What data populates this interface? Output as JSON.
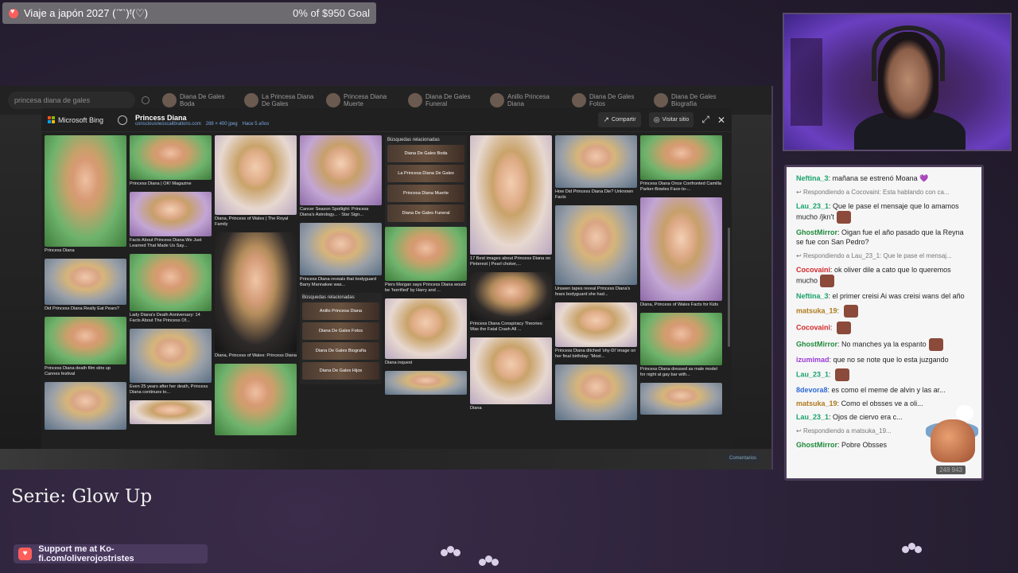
{
  "goal": {
    "title": "Viaje a japón 2027 (ˊ˘ˋ)ᶠ(♡)",
    "amount": "0% of $950 Goal"
  },
  "browser": {
    "search_query": "princesa diana de gales",
    "top_related": [
      "Diana De Gales Boda",
      "La Princesa Diana De Gales",
      "Princesa Diana Muerte",
      "Diana De Gales Funeral",
      "Anillo Princesa Diana",
      "Diana De Gales Fotos",
      "Diana De Gales Biografía"
    ],
    "modal": {
      "brand": "Microsoft Bing",
      "title": "Princess Diana",
      "source": "consciousnesscalibrations.com",
      "dims": "288 × 400 jpeg",
      "age": "Hace 5 años",
      "share_label": "Compartir",
      "visit_label": "Visitar sitio"
    },
    "columns": [
      [
        {
          "h": 140,
          "cap": "Princess Diana",
          "v": "v4"
        },
        {
          "h": 58,
          "cap": "Did Princess Diana Really Eat Pears?",
          "v": "v2"
        },
        {
          "h": 60,
          "cap": "Princess Diana death film stirs up Cannes festival",
          "v": "v4"
        },
        {
          "h": 60,
          "cap": "",
          "v": "v2"
        }
      ],
      [
        {
          "h": 56,
          "cap": "Princess Diana | OK! Magazine",
          "v": "v4"
        },
        {
          "h": 56,
          "cap": "Facts About Princess Diana We Just Learned That Made Us Say...",
          "v": "v5"
        },
        {
          "h": 72,
          "cap": "Lady Diana's Death Anniversary: 14 Facts About The Princess Of...",
          "v": "v4"
        },
        {
          "h": 68,
          "cap": "Even 25 years after her death, Princess Diana continues to...",
          "v": "v2"
        },
        {
          "h": 30,
          "cap": "",
          "v": "v3"
        }
      ],
      [
        {
          "h": 100,
          "cap": "Diana, Princess of Wales | The Royal Family",
          "v": "v3"
        },
        {
          "h": 150,
          "cap": "Diana, Princess of Wales: Princess Diana",
          "v": "v6"
        },
        {
          "h": 90,
          "cap": "",
          "v": "v4"
        }
      ],
      [
        {
          "h": 88,
          "cap": "Cancer Season Spotlight: Princess Diana's Astrology... - Star Sign...",
          "v": "v5"
        },
        {
          "h": 66,
          "cap": "Princess Diana reveals that bodyguard Barry Mannakee was...",
          "v": "v2"
        }
      ],
      [
        {
          "h": 68,
          "cap": "Piers Morgan says Princess Diana would be 'horrified' by Harry and ...",
          "v": "v4"
        },
        {
          "h": 76,
          "cap": "Diana inquest",
          "v": "v3"
        },
        {
          "h": 30,
          "cap": "",
          "v": "v2"
        }
      ],
      [
        {
          "h": 150,
          "cap": "17 Best images about Princess Diana on Pinterest | Pearl choker,...",
          "v": "v3"
        },
        {
          "h": 60,
          "cap": "Princess Diana Conspiracy Theories: Was the Fatal Crash All ...",
          "v": "v6"
        },
        {
          "h": 84,
          "cap": "Diana",
          "v": "v3"
        }
      ],
      [
        {
          "h": 66,
          "cap": "How Did Princess Diana Die? Unknown Facts",
          "v": "v2"
        },
        {
          "h": 100,
          "cap": "Unseen tapes reveal Princess Diana's fears bodyguard she had...",
          "v": "v2"
        },
        {
          "h": 56,
          "cap": "Princess Diana ditched 'shy-Di' image on her final birthday: 'Most...",
          "v": "v3"
        },
        {
          "h": 70,
          "cap": "",
          "v": "v2"
        }
      ],
      [
        {
          "h": 56,
          "cap": "Princess Diana Once Confronted Camilla Parker-Bowles Face-to-...",
          "v": "v4"
        },
        {
          "h": 130,
          "cap": "Diana, Princess of Wales Facts for Kids",
          "v": "v5"
        },
        {
          "h": 66,
          "cap": "Princess Diana dressed as male model for night at gay bar with...",
          "v": "v4"
        },
        {
          "h": 40,
          "cap": "",
          "v": "v2"
        }
      ]
    ],
    "related_a": {
      "title": "Búsquedas relacionadas",
      "items": [
        "Diana De Gales Boda",
        "La Princesa Diana De Gales",
        "Princesa Diana Muerte",
        "Diana De Gales Funeral"
      ]
    },
    "related_b": {
      "title": "Búsquedas relacionadas",
      "items": [
        "Anillo Princesa Diana",
        "Diana De Gales Fotos",
        "Diana De Gales Biografía",
        "Diana De Gales Hijos"
      ]
    },
    "footer_button": "Comentarios"
  },
  "chat": {
    "messages": [
      {
        "user": "Neftina_3",
        "color": "#1aa36a",
        "text": "mañana se estrenó Moana 💜"
      },
      {
        "reply": "Respondiendo a Cocovaini: Esta hablando con ca..."
      },
      {
        "user": "Lau_23_1",
        "color": "#1aa36a",
        "text": "Que le pase el mensaje que lo amamos mucho /jkn't",
        "emote": true
      },
      {
        "user": "GhostMirror",
        "color": "#1f8a3a",
        "text": "Oigan fue el año pasado que la Reyna se fue con San Pedro?"
      },
      {
        "reply": "Respondiendo a Lau_23_1: Que le pase el mensaj..."
      },
      {
        "user": "Cocovaini",
        "color": "#d4282a",
        "text": "ok oliver dile a cato que lo queremos mucho",
        "emote": true
      },
      {
        "user": "Neftina_3",
        "color": "#1aa36a",
        "text": "el primer creisi Ai was creisi wans del año"
      },
      {
        "user": "matsuka_19",
        "color": "#b07a1a",
        "text": "",
        "emote": true
      },
      {
        "user": "Cocovaini",
        "color": "#d4282a",
        "text": "",
        "emote": true
      },
      {
        "user": "GhostMirror",
        "color": "#1f8a3a",
        "text": "No manches ya la espanto",
        "emote": true
      },
      {
        "user": "izumimad",
        "color": "#9a3ad4",
        "text": "que no se note que lo esta juzgando"
      },
      {
        "user": "Lau_23_1",
        "color": "#1aa36a",
        "text": "",
        "emote": true
      },
      {
        "user": "8devora8",
        "color": "#2f6ad4",
        "text": "es como el meme de alvin y las ar..."
      },
      {
        "user": "matsuka_19",
        "color": "#b07a1a",
        "text": "Como el obsses ve a oli..."
      },
      {
        "user": "Lau_23_1",
        "color": "#1aa36a",
        "text": "Ojos de ciervo era c..."
      },
      {
        "reply": "Respondiendo a matsuka_19..."
      },
      {
        "user": "GhostMirror",
        "color": "#1f8a3a",
        "text": "Pobre Obsses"
      }
    ],
    "viewers": "248 943"
  },
  "series": "Serie: Glow Up",
  "kofi": {
    "text": "Support me at Ko-fi.com/oliverojostristes"
  }
}
